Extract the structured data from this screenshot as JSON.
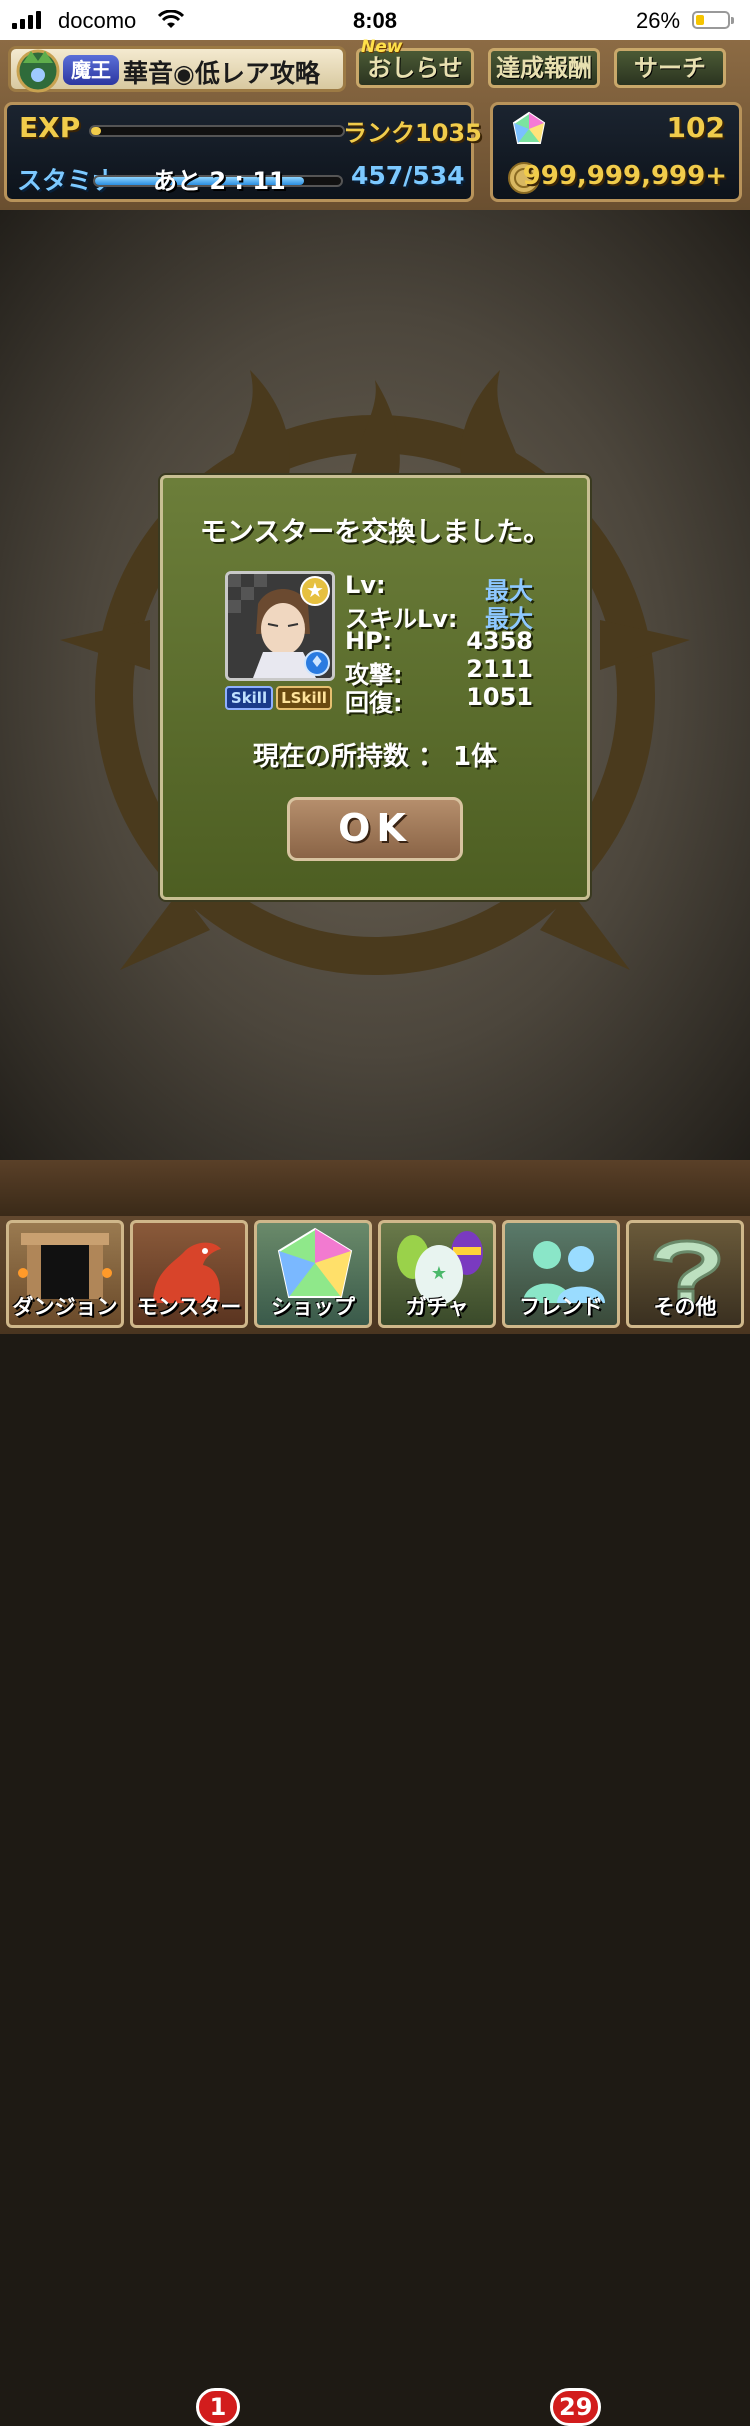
{
  "status_bar": {
    "carrier": "docomo",
    "time": "8:08",
    "battery_percent": "26%",
    "battery_level": 0.26
  },
  "header": {
    "rank_badge": "魔王",
    "player_name": "華音◉低レア攻略",
    "new_badge": "New",
    "news_button": "おしらせ",
    "achievements_button": "達成報酬",
    "search_button": "サーチ",
    "exp_label": "EXP",
    "exp_progress": 0.02,
    "rank_text": "ランク1035",
    "stamina_label": "スタミナ",
    "stamina_timer": "あと 2 : 11",
    "stamina_fraction": 0.85,
    "stamina_value": "457/534",
    "magic_stones": "102",
    "coins": "999,999,999+"
  },
  "dialog": {
    "title": "モンスターを交換しました。",
    "skill_badge": "Skill",
    "lskill_badge": "LSkill",
    "stats": [
      {
        "label": "Lv:",
        "value": "最大"
      },
      {
        "label": "スキルLv:",
        "value": "最大"
      },
      {
        "label": "HP:",
        "value": "4358"
      },
      {
        "label": "攻撃:",
        "value": "2111"
      },
      {
        "label": "回復:",
        "value": "1051"
      }
    ],
    "owned_count": "現在の所持数 ： 1体",
    "ok_button": "OK"
  },
  "bottom_nav": {
    "items": [
      {
        "label": "ダンジョン",
        "icon": "dungeon-gate-icon"
      },
      {
        "label": "モンスター",
        "icon": "dragon-icon",
        "badge": "1"
      },
      {
        "label": "ショップ",
        "icon": "magic-stone-icon"
      },
      {
        "label": "ガチャ",
        "icon": "egg-icon"
      },
      {
        "label": "フレンド",
        "icon": "friends-icon",
        "badge": "29"
      },
      {
        "label": "その他",
        "icon": "question-icon"
      }
    ]
  },
  "colors": {
    "dialog_green": "#5b6d2c",
    "gold_text": "#f1cc4b",
    "stat_blue": "#8ec8ff",
    "badge_red": "#d21d1d"
  }
}
